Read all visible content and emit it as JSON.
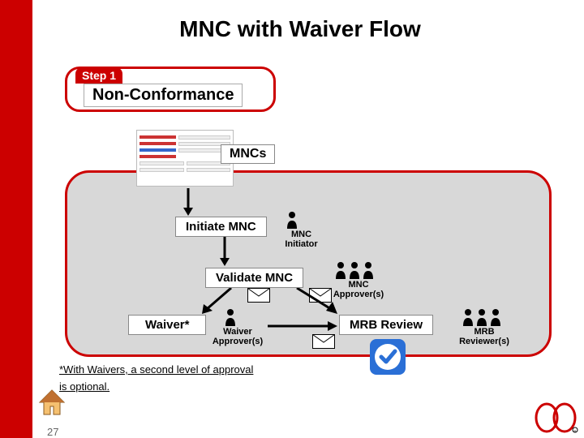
{
  "title": "MNC with Waiver Flow",
  "step": {
    "label": "Step 1",
    "name": "Non-Conformance"
  },
  "panel": {
    "tag": "MNCs"
  },
  "nodes": {
    "initiate": "Initiate MNC",
    "validate": "Validate MNC",
    "waiver": "Waiver*",
    "mrb": "MRB Review"
  },
  "roles": {
    "initiator": "MNC\nInitiator",
    "approvers": "MNC\nApprover(s)",
    "waiver_approvers": "Waiver\nApprover(s)",
    "mrb_reviewers": "MRB\nReviewer(s)"
  },
  "footnote": "*With Waivers, a second level of approval\nis optional.",
  "page": "27"
}
